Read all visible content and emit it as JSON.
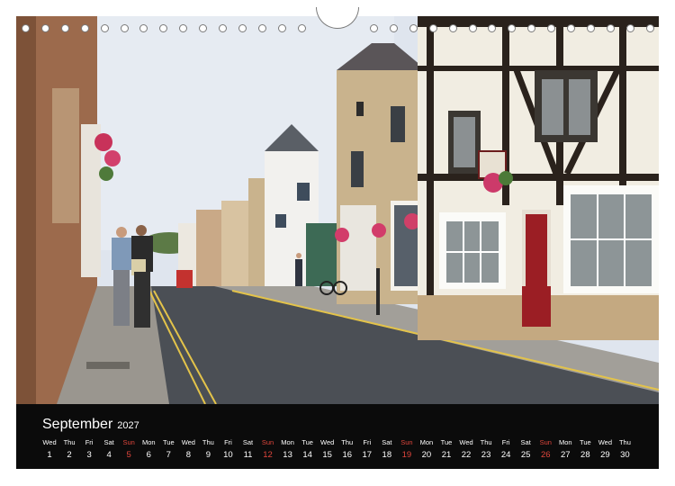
{
  "calendar": {
    "month": "September",
    "year": "2027",
    "weekend_color": "#e0463c",
    "days": [
      {
        "dn": "Wed",
        "d": "1"
      },
      {
        "dn": "Thu",
        "d": "2"
      },
      {
        "dn": "Fri",
        "d": "3"
      },
      {
        "dn": "Sat",
        "d": "4"
      },
      {
        "dn": "Sun",
        "d": "5",
        "sun": true
      },
      {
        "dn": "Mon",
        "d": "6"
      },
      {
        "dn": "Tue",
        "d": "7"
      },
      {
        "dn": "Wed",
        "d": "8"
      },
      {
        "dn": "Thu",
        "d": "9"
      },
      {
        "dn": "Fri",
        "d": "10"
      },
      {
        "dn": "Sat",
        "d": "11"
      },
      {
        "dn": "Sun",
        "d": "12",
        "sun": true
      },
      {
        "dn": "Mon",
        "d": "13"
      },
      {
        "dn": "Tue",
        "d": "14"
      },
      {
        "dn": "Wed",
        "d": "15"
      },
      {
        "dn": "Thu",
        "d": "16"
      },
      {
        "dn": "Fri",
        "d": "17"
      },
      {
        "dn": "Sat",
        "d": "18"
      },
      {
        "dn": "Sun",
        "d": "19",
        "sun": true
      },
      {
        "dn": "Mon",
        "d": "20"
      },
      {
        "dn": "Tue",
        "d": "21"
      },
      {
        "dn": "Wed",
        "d": "22"
      },
      {
        "dn": "Thu",
        "d": "23"
      },
      {
        "dn": "Fri",
        "d": "24"
      },
      {
        "dn": "Sat",
        "d": "25"
      },
      {
        "dn": "Sun",
        "d": "26",
        "sun": true
      },
      {
        "dn": "Mon",
        "d": "27"
      },
      {
        "dn": "Tue",
        "d": "28"
      },
      {
        "dn": "Wed",
        "d": "29"
      },
      {
        "dn": "Thu",
        "d": "30"
      }
    ]
  },
  "photo": {
    "subject": "street-of-historic-english-town-icon",
    "sky_color": "#dfe5ee",
    "stone_color": "#c9b38d",
    "road_color": "#4b4f55"
  }
}
